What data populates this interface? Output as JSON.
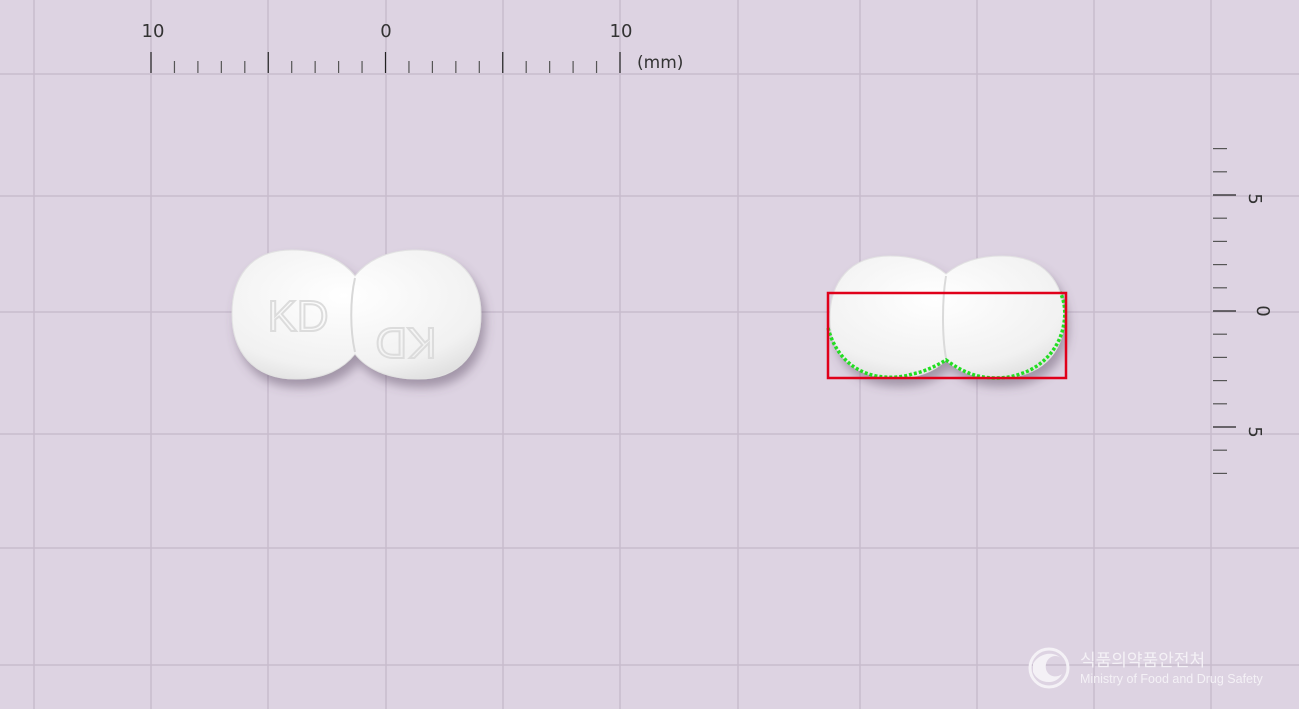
{
  "top_ruler": {
    "labels": [
      "10",
      "0",
      "10"
    ],
    "unit": "(mm)"
  },
  "side_ruler": {
    "labels": [
      "5",
      "0",
      "5"
    ]
  },
  "pill_front": {
    "imprint_left": "KD",
    "imprint_right": "KD"
  },
  "logo": {
    "korean": "식품의약품안전처",
    "english": "Ministry of Food and Drug Safety"
  },
  "colors": {
    "background": "#ddd3e2",
    "grid": "#c8bccd",
    "pill": "#f5f5f5",
    "bbox": "#e0001a",
    "contour": "#22dd22"
  }
}
